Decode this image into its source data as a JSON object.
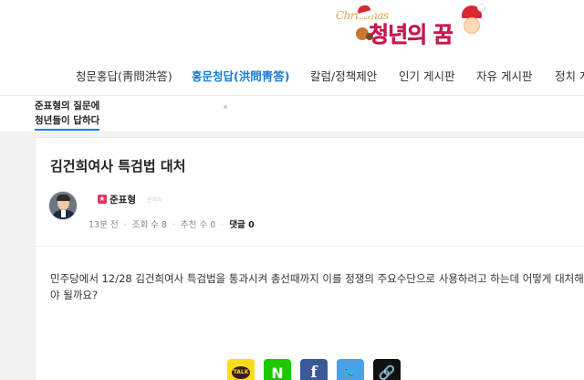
{
  "header": {
    "logo_script": "Christmas",
    "logo_main": "청년의 꿈"
  },
  "nav": {
    "items": [
      {
        "label": "청문홍답(靑問洪答)",
        "active": false
      },
      {
        "label": "홍문청답(洪問靑答)",
        "active": true
      },
      {
        "label": "칼럼/정책제안",
        "active": false
      },
      {
        "label": "인기 게시판",
        "active": false
      },
      {
        "label": "자유 게시판",
        "active": false
      },
      {
        "label": "정치 게",
        "active": false
      }
    ]
  },
  "subheader": {
    "line1": "준표형의 질문에",
    "line2": "청년들이 답하다"
  },
  "post": {
    "title": "김건희여사 특검법 대처",
    "author": {
      "name": "준표형",
      "role": "관리자",
      "badge": "★"
    },
    "meta": {
      "time": "13분 전",
      "views_label": "조회 수 8",
      "likes_label": "추천 수 0",
      "comments_label": "댓글 0"
    },
    "body": "민주당에서 12/28 김건희여사 특검법을 통과시켜 총선때까지 이를 정쟁의 주요수단으로 사용하려고 하는데 어떻게 대처해야 될까요?"
  },
  "share": {
    "kakao_label": "TALK",
    "naver_label": "N",
    "facebook_label": "f",
    "twitter_label": "🐦",
    "link_label": "🔗"
  },
  "colors": {
    "accent": "#1a7bd6",
    "brand": "#e0235b",
    "kakao": "#f7dd18",
    "naver": "#1ec800",
    "facebook": "#3b5998",
    "twitter": "#4aa1e6"
  }
}
